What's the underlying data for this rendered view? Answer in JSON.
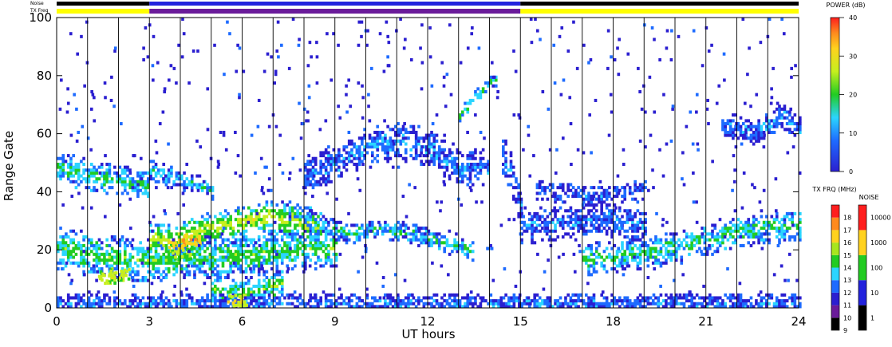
{
  "chart_data": {
    "type": "heatmap",
    "xlabel": "UT hours",
    "ylabel": "Range Gate",
    "xlim": [
      0,
      24
    ],
    "ylim": [
      0,
      100
    ],
    "x_ticks": [
      0,
      3,
      6,
      9,
      12,
      15,
      18,
      21,
      24
    ],
    "y_ticks": [
      0,
      20,
      40,
      60,
      80,
      100
    ],
    "hour_gridlines": [
      1,
      2,
      3,
      4,
      5,
      6,
      7,
      8,
      9,
      10,
      11,
      12,
      13,
      14,
      15,
      16,
      17,
      18,
      19,
      20,
      21,
      22,
      23
    ],
    "header_rows": {
      "noise": {
        "label": "Noise",
        "segments": [
          {
            "from": 0,
            "to": 3,
            "color": "#000000"
          },
          {
            "from": 3,
            "to": 15,
            "color": "#2222dd"
          },
          {
            "from": 15,
            "to": 24,
            "color": "#000000"
          }
        ]
      },
      "tx_freq": {
        "label": "TX Freq",
        "segments": [
          {
            "from": 0,
            "to": 3,
            "color": "#ffff00"
          },
          {
            "from": 3,
            "to": 15,
            "color": "#6a1b9a"
          },
          {
            "from": 15,
            "to": 24,
            "color": "#ffff00"
          }
        ]
      }
    },
    "power_scale": {
      "title": "POWER (dB)",
      "ticks": [
        0,
        10,
        20,
        30,
        40
      ],
      "range": [
        0,
        40
      ]
    },
    "freq_scale": {
      "title": "TX FRQ (MHz)",
      "ticks": [
        9,
        10,
        11,
        12,
        13,
        14,
        15,
        16,
        17,
        18
      ],
      "colors": [
        "#000000",
        "#6a1b9a",
        "#2b1fd0",
        "#1e6bff",
        "#2bd5ff",
        "#22cc22",
        "#a8e61e",
        "#ffd21e",
        "#ff8a1e",
        "#ff1e1e"
      ]
    },
    "noise_scale": {
      "title": "NOISE",
      "ticks": [
        1,
        10,
        100,
        1000,
        10000
      ],
      "colors": [
        "#000000",
        "#2222dd",
        "#22cc22",
        "#ffd21e",
        "#ff1e1e"
      ]
    },
    "echo_bands": [
      {
        "points": [
          [
            0,
            48
          ],
          [
            1.5,
            44
          ],
          [
            2.5,
            42
          ],
          [
            3,
            41
          ]
        ],
        "width": 5,
        "power": 13
      },
      {
        "points": [
          [
            3,
            47
          ],
          [
            4.5,
            42
          ],
          [
            5,
            40
          ]
        ],
        "width": 3,
        "power": 10
      },
      {
        "points": [
          [
            0,
            20
          ],
          [
            1.5,
            17
          ],
          [
            3,
            16
          ],
          [
            5,
            17
          ],
          [
            7,
            19
          ],
          [
            8.2,
            20
          ],
          [
            9,
            20
          ]
        ],
        "width": 7,
        "power": 15
      },
      {
        "points": [
          [
            3,
            23
          ],
          [
            3.8,
            23
          ],
          [
            4.6,
            26
          ],
          [
            5.5,
            28
          ],
          [
            6.5,
            31
          ],
          [
            7.5,
            30
          ],
          [
            8.5,
            28
          ]
        ],
        "width": 5,
        "power": 22
      },
      {
        "points": [
          [
            7.5,
            33
          ],
          [
            8.5,
            28
          ],
          [
            9.5,
            25
          ],
          [
            10.5,
            27
          ],
          [
            11.5,
            25
          ],
          [
            12.5,
            22
          ],
          [
            13.5,
            19
          ]
        ],
        "width": 3,
        "power": 11
      },
      {
        "points": [
          [
            8,
            44
          ],
          [
            9,
            50
          ],
          [
            10,
            55
          ],
          [
            11,
            57
          ],
          [
            12,
            55
          ],
          [
            13,
            47
          ],
          [
            14,
            48
          ]
        ],
        "width": 6,
        "power": 7
      },
      {
        "points": [
          [
            13,
            66
          ],
          [
            13.8,
            75
          ],
          [
            14.2,
            78
          ]
        ],
        "width": 2,
        "power": 14
      },
      {
        "points": [
          [
            14.4,
            52
          ],
          [
            14.8,
            42
          ],
          [
            15,
            35
          ]
        ],
        "width": 7,
        "power": 6
      },
      {
        "points": [
          [
            15,
            27
          ],
          [
            16.5,
            29
          ],
          [
            17.5,
            30
          ],
          [
            19,
            28
          ]
        ],
        "width": 5,
        "power": 6
      },
      {
        "points": [
          [
            17,
            16
          ],
          [
            18.5,
            18
          ],
          [
            20,
            20
          ],
          [
            21,
            23
          ],
          [
            22,
            26
          ],
          [
            24,
            28
          ]
        ],
        "width": 5,
        "power": 13
      },
      {
        "points": [
          [
            15.5,
            40
          ],
          [
            17.5,
            38
          ],
          [
            19,
            40
          ]
        ],
        "width": 3,
        "power": 5
      },
      {
        "points": [
          [
            21.5,
            63
          ],
          [
            22.5,
            60
          ],
          [
            23.5,
            66
          ],
          [
            24,
            61
          ]
        ],
        "width": 4,
        "power": 7
      },
      {
        "points": [
          [
            5,
            6
          ],
          [
            6,
            4
          ],
          [
            7.3,
            8
          ]
        ],
        "width": 5,
        "power": 15
      },
      {
        "points": [
          [
            0,
            1
          ],
          [
            24,
            1
          ]
        ],
        "width": 3,
        "power": 6
      }
    ],
    "hotspots": [
      {
        "x": 3.9,
        "y": 21,
        "power": 33
      },
      {
        "x": 4.3,
        "y": 23,
        "power": 35
      },
      {
        "x": 1.6,
        "y": 10,
        "power": 26
      },
      {
        "x": 2.0,
        "y": 11,
        "power": 27
      },
      {
        "x": 5.8,
        "y": 2,
        "power": 30
      },
      {
        "x": 4.0,
        "y": 18,
        "power": 23
      }
    ]
  }
}
